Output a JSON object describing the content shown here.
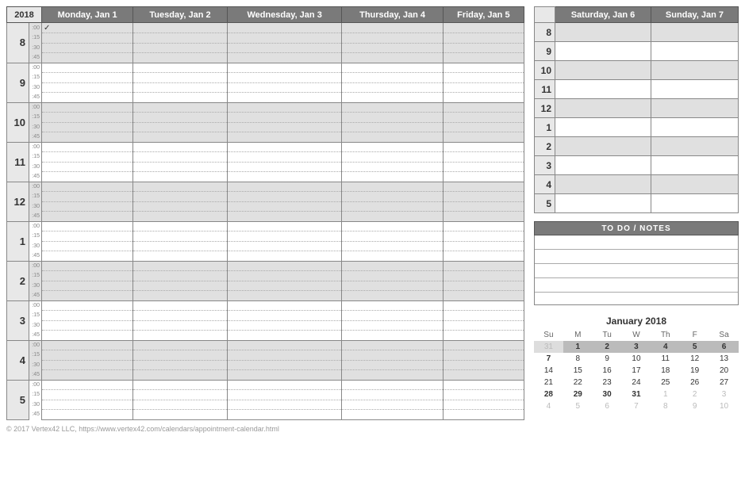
{
  "year": "2018",
  "weekdays": [
    "Monday, Jan 1",
    "Tuesday, Jan 2",
    "Wednesday, Jan 3",
    "Thursday, Jan 4",
    "Friday, Jan 5"
  ],
  "weekend": [
    "Saturday, Jan 6",
    "Sunday, Jan 7"
  ],
  "hours": [
    "8",
    "9",
    "10",
    "11",
    "12",
    "1",
    "2",
    "3",
    "4",
    "5"
  ],
  "subs": [
    ":00",
    ":15",
    ":30",
    ":45"
  ],
  "weekend_hours": [
    "8",
    "9",
    "10",
    "11",
    "12",
    "1",
    "2",
    "3",
    "4",
    "5"
  ],
  "todo_header": "TO DO  /  NOTES",
  "checkmark": "✓",
  "mini": {
    "title": "January 2018",
    "dow": [
      "Su",
      "M",
      "Tu",
      "W",
      "Th",
      "F",
      "Sa"
    ],
    "rows": [
      {
        "cells": [
          "31",
          "1",
          "2",
          "3",
          "4",
          "5",
          "6"
        ],
        "hl": true,
        "other": [
          0
        ],
        "bold": [
          1,
          2,
          3,
          4,
          5,
          6
        ]
      },
      {
        "cells": [
          "7",
          "8",
          "9",
          "10",
          "11",
          "12",
          "13"
        ],
        "hl": false,
        "other": [],
        "bold": [
          0
        ]
      },
      {
        "cells": [
          "14",
          "15",
          "16",
          "17",
          "18",
          "19",
          "20"
        ],
        "hl": false,
        "other": [],
        "bold": []
      },
      {
        "cells": [
          "21",
          "22",
          "23",
          "24",
          "25",
          "26",
          "27"
        ],
        "hl": false,
        "other": [],
        "bold": []
      },
      {
        "cells": [
          "28",
          "29",
          "30",
          "31",
          "1",
          "2",
          "3"
        ],
        "hl": false,
        "other": [
          4,
          5,
          6
        ],
        "bold": [
          0,
          1,
          2,
          3
        ]
      },
      {
        "cells": [
          "4",
          "5",
          "6",
          "7",
          "8",
          "9",
          "10"
        ],
        "hl": false,
        "other": [
          0,
          1,
          2,
          3,
          4,
          5,
          6
        ],
        "bold": []
      }
    ]
  },
  "footer": "© 2017 Vertex42 LLC, https://www.vertex42.com/calendars/appointment-calendar.html"
}
